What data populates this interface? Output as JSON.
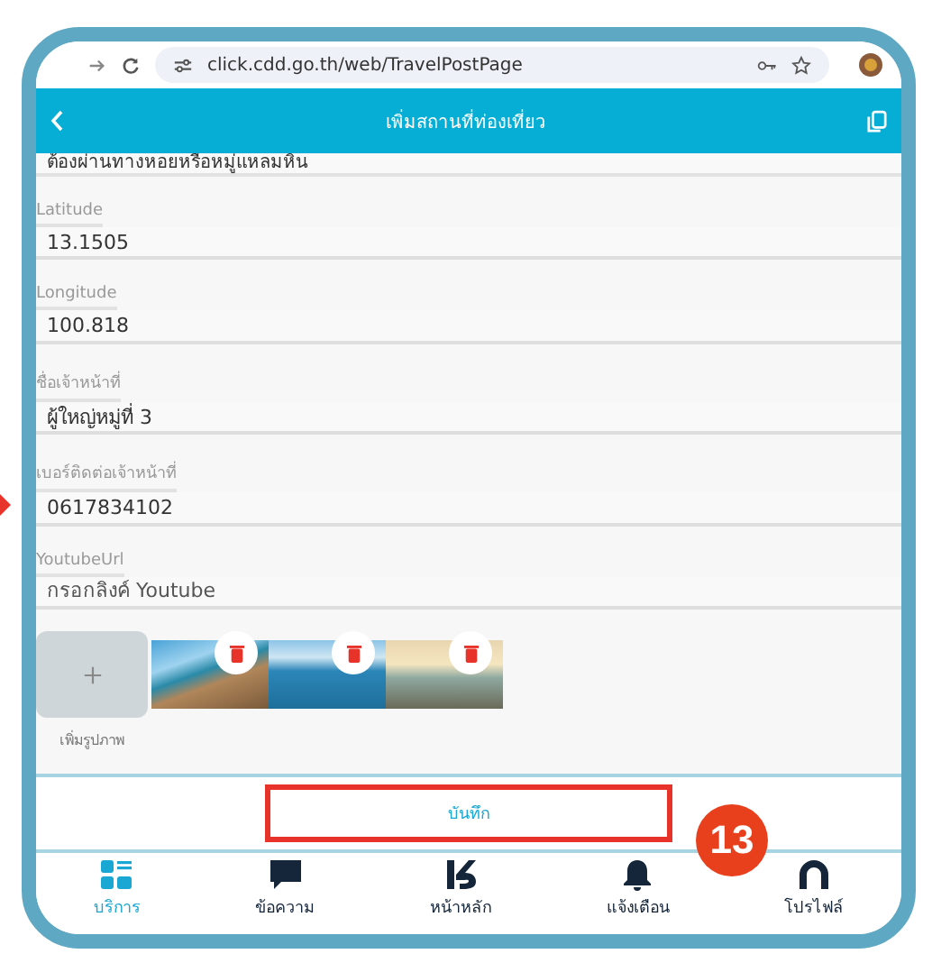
{
  "browser": {
    "url": "click.cdd.go.th/web/TravelPostPage"
  },
  "header": {
    "title": "เพิ่มสถานที่ท่องเที่ยว"
  },
  "cut_text": "ต้องผ่านทางหอยหรือหมู่แหลมหิน",
  "fields": [
    {
      "label": "Latitude",
      "value": "13.1505"
    },
    {
      "label": "Longitude",
      "value": "100.818"
    },
    {
      "label": "ชื่อเจ้าหน้าที่",
      "value": "ผู้ใหญ่หมู่ที่ 3"
    },
    {
      "label": "เบอร์ติดต่อเจ้าหน้าที่",
      "value": "0617834102"
    },
    {
      "label": "YoutubeUrl",
      "placeholder": "กรอกลิงค์ Youtube"
    }
  ],
  "photos": {
    "add_label": "เพิ่มรูปภาพ",
    "items": [
      {
        "kind": "pier"
      },
      {
        "kind": "jetty"
      },
      {
        "kind": "sunset"
      }
    ]
  },
  "save_button": "บันทึก",
  "callout": "13",
  "nav": [
    {
      "label": "บริการ",
      "kind": "grid",
      "selected": true
    },
    {
      "label": "ข้อความ",
      "kind": "chat",
      "selected": false
    },
    {
      "label": "หน้าหลัก",
      "kind": "logo",
      "selected": false
    },
    {
      "label": "แจ้งเตือน",
      "kind": "bell",
      "selected": false
    },
    {
      "label": "โปรไฟล์",
      "kind": "person",
      "selected": false
    }
  ]
}
